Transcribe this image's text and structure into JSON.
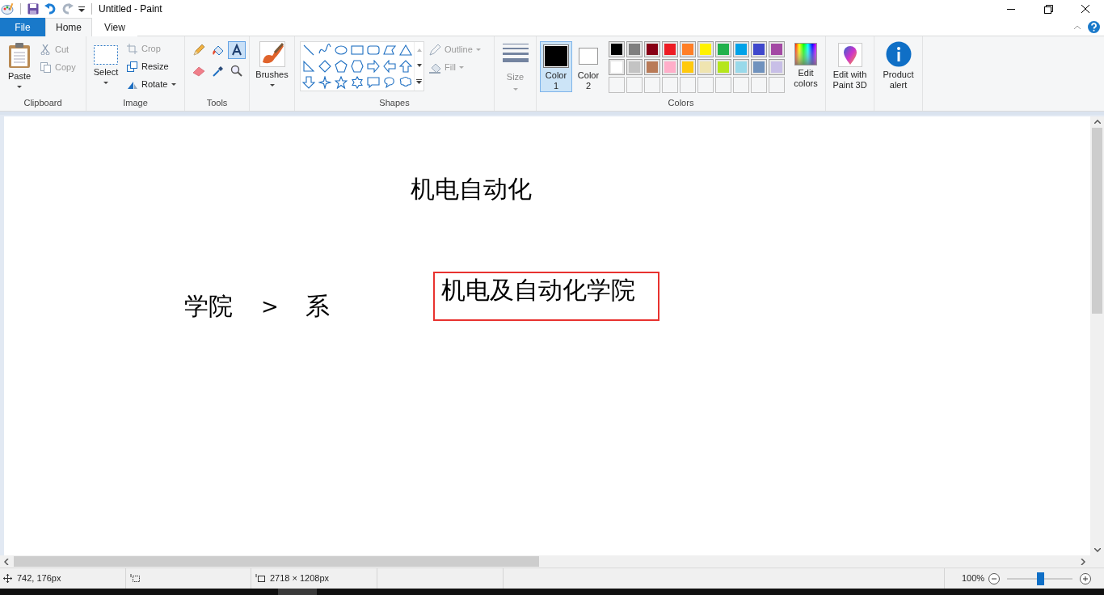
{
  "window": {
    "title": "Untitled - Paint"
  },
  "menu_tabs": [
    {
      "label": "File",
      "kind": "file",
      "selected": false
    },
    {
      "label": "Home",
      "kind": "tab",
      "selected": true
    },
    {
      "label": "View",
      "kind": "tab",
      "selected": false
    }
  ],
  "clipboard": {
    "label": "Clipboard",
    "paste": "Paste",
    "items": [
      {
        "label": "Cut",
        "kind": "cut",
        "disabled": true
      },
      {
        "label": "Copy",
        "kind": "copy",
        "disabled": true
      }
    ]
  },
  "image": {
    "label": "Image",
    "select": "Select",
    "items": [
      {
        "label": "Crop",
        "kind": "crop",
        "disabled": true,
        "has_menu": false
      },
      {
        "label": "Resize",
        "kind": "resize",
        "disabled": false,
        "has_menu": false
      },
      {
        "label": "Rotate",
        "kind": "rotate",
        "disabled": false,
        "has_menu": true
      }
    ]
  },
  "tools": {
    "label": "Tools",
    "items": [
      {
        "kind": "pencil",
        "selected": false
      },
      {
        "kind": "fill",
        "selected": false
      },
      {
        "kind": "text",
        "selected": true
      },
      {
        "kind": "eraser",
        "selected": false
      },
      {
        "kind": "picker",
        "selected": false
      },
      {
        "kind": "magnifier",
        "selected": false
      }
    ]
  },
  "brushes": {
    "label": "Brushes"
  },
  "shapes": {
    "label": "Shapes",
    "outline": {
      "label": "Outline",
      "disabled": true
    },
    "fill": {
      "label": "Fill",
      "disabled": true
    }
  },
  "size": {
    "label": "Size",
    "disabled": true
  },
  "colors": {
    "label": "Colors",
    "active": [
      {
        "label": "Color 1",
        "color": "#000000",
        "selected": true
      },
      {
        "label": "Color 2",
        "color": "#ffffff",
        "selected": false
      }
    ],
    "palette": [
      {
        "color": "#000000"
      },
      {
        "color": "#7f7f7f"
      },
      {
        "color": "#880015"
      },
      {
        "color": "#ed1c24"
      },
      {
        "color": "#ff7f27"
      },
      {
        "color": "#fff200"
      },
      {
        "color": "#22b14c"
      },
      {
        "color": "#00a2e8"
      },
      {
        "color": "#3f48cc"
      },
      {
        "color": "#a349a4"
      },
      {
        "color": "#ffffff"
      },
      {
        "color": "#c3c3c3"
      },
      {
        "color": "#b97a57"
      },
      {
        "color": "#ffaec9"
      },
      {
        "color": "#ffc90e"
      },
      {
        "color": "#efe4b0"
      },
      {
        "color": "#b5e61d"
      },
      {
        "color": "#99d9ea"
      },
      {
        "color": "#7092be"
      },
      {
        "color": "#c8bfe7"
      }
    ],
    "edit": "Edit colors"
  },
  "extra_buttons": [
    {
      "label": "Edit with Paint 3D",
      "kind": "paint3d"
    },
    {
      "label": "Product alert",
      "kind": "info"
    }
  ],
  "canvas": {
    "texts": [
      {
        "text": "机电自动化",
        "boxed": false
      },
      {
        "text": "学院",
        "boxed": false
      },
      {
        "text": ">",
        "boxed": false
      },
      {
        "text": "系",
        "boxed": false
      },
      {
        "text": "机电及自动化学院",
        "boxed": true
      }
    ]
  },
  "status_bar": {
    "cursor_position": "742, 176px",
    "canvas_size": "2718 × 1208px",
    "zoom": {
      "label": "100%",
      "level": 0.5
    }
  }
}
